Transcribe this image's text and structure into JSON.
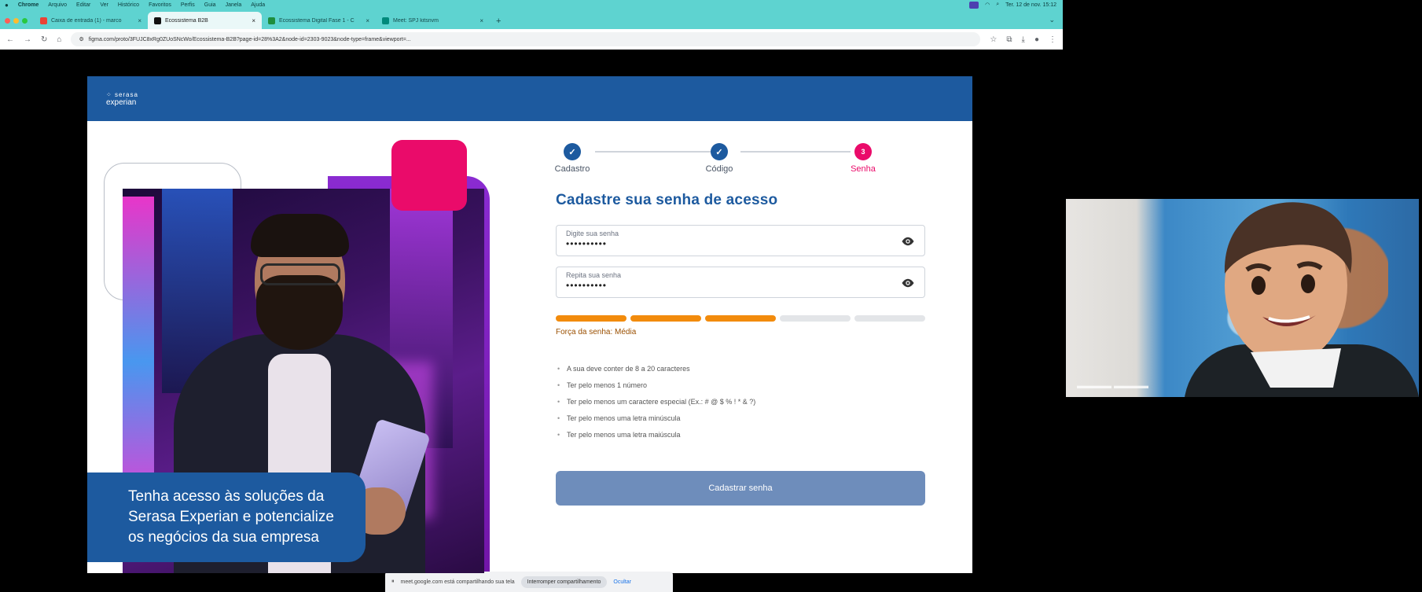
{
  "menubar": {
    "items": [
      "Chrome",
      "Arquivo",
      "Editar",
      "Ver",
      "Histórico",
      "Favoritos",
      "Perfis",
      "Guia",
      "Janela",
      "Ajuda"
    ],
    "clock": "Ter. 12 de nov.  15:12"
  },
  "tabs": [
    {
      "label": "Caixa de entrada (1) - marco",
      "color": "#ea4335",
      "active": false
    },
    {
      "label": "Ecossistema B2B",
      "color": "#111111",
      "active": true
    },
    {
      "label": "Ecossistema Digital Fase 1 - C",
      "color": "#1e8e3e",
      "active": false
    },
    {
      "label": "Meet: SPJ kitsnvm",
      "color": "#00897b",
      "active": false
    }
  ],
  "address": {
    "url": "figma.com/proto/3FUJC8xRg0ZUoSNcWo/Ecossistema-B2B?page-id=28%3A2&node-id=2303-9023&node-type=frame&viewport=..."
  },
  "brand": {
    "line1": "serasa",
    "line2": "experian"
  },
  "hero": {
    "banner": "Tenha acesso às soluções da Serasa Experian e potencialize os negócios da sua empresa"
  },
  "stepper": {
    "steps": [
      {
        "label": "Cadastro",
        "mark": "✓"
      },
      {
        "label": "Código",
        "mark": "✓"
      },
      {
        "label": "Senha",
        "mark": "3"
      }
    ]
  },
  "form": {
    "title": "Cadastre sua senha de acesso",
    "password_label": "Digite sua senha",
    "password_value": "••••••••••",
    "confirm_label": "Repita sua senha",
    "confirm_value": "••••••••••",
    "strength_level": 3,
    "strength_total": 5,
    "strength_text": "Força da senha: Média",
    "rules": [
      "A sua deve conter de 8 a 20 caracteres",
      "Ter pelo menos 1 número",
      "Ter pelo menos um caractere especial (Ex.: # @ $ % ! * & ?)",
      "Ter pelo menos uma letra minúscula",
      "Ter pelo menos uma letra maiúscula"
    ],
    "submit_label": "Cadastrar senha"
  },
  "sharebar": {
    "text": "meet.google.com está compartilhando sua tela",
    "stop_label": "Interromper compartilhamento",
    "hide_label": "Ocultar"
  },
  "colors": {
    "brand_blue": "#1d5a9f",
    "brand_pink": "#ea0b6a",
    "strength_orange": "#f28b0c",
    "button_disabled": "#6e8dbb"
  }
}
